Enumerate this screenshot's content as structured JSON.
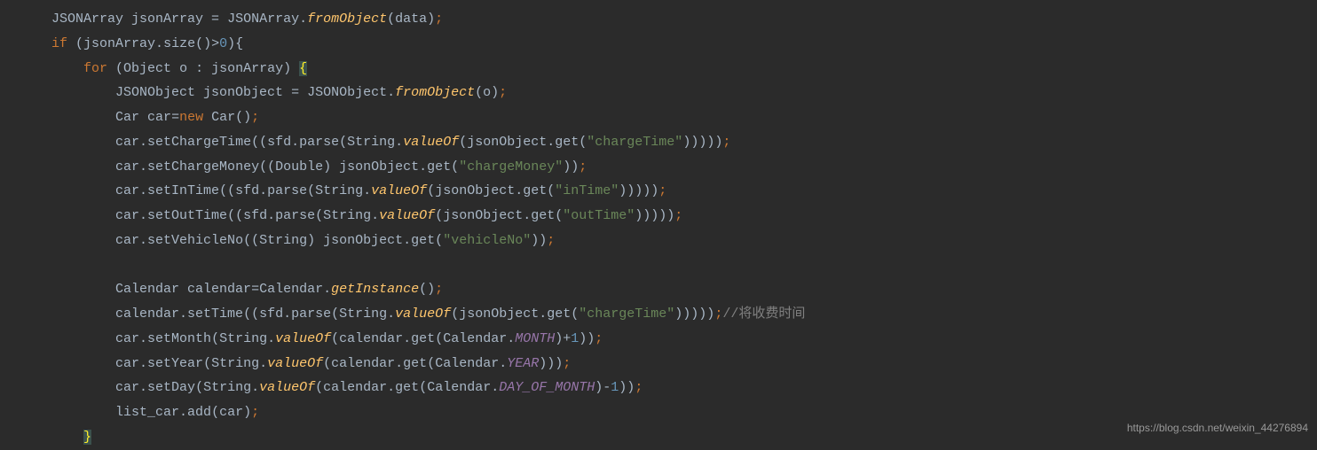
{
  "code": {
    "l1": {
      "type": "JSONArray",
      "var": "jsonArray",
      "eq": " = ",
      "cls": "JSONArray",
      "dot": ".",
      "method": "fromObject",
      "arg": "data"
    },
    "l2": {
      "kw": "if",
      "var": "jsonArray",
      "method": "size",
      "op": ">",
      "num": "0"
    },
    "l3": {
      "kw": "for",
      "type": "Object",
      "var": "o",
      "colon": " : ",
      "iter": "jsonArray"
    },
    "l4": {
      "type": "JSONObject",
      "var": "jsonObject",
      "eq": " = ",
      "cls": "JSONObject",
      "method": "fromObject",
      "arg": "o"
    },
    "l5": {
      "type": "Car",
      "var": "car",
      "newkw": "new",
      "ctor": "Car"
    },
    "l6": {
      "var": "car",
      "method": "setChargeTime",
      "sfd": "sfd",
      "parse": "parse",
      "strcls": "String",
      "valueof": "valueOf",
      "jo": "jsonObject",
      "get": "get",
      "str": "\"chargeTime\""
    },
    "l7": {
      "var": "car",
      "method": "setChargeMoney",
      "cast": "Double",
      "jo": "jsonObject",
      "get": "get",
      "str": "\"chargeMoney\""
    },
    "l8": {
      "var": "car",
      "method": "setInTime",
      "sfd": "sfd",
      "parse": "parse",
      "strcls": "String",
      "valueof": "valueOf",
      "jo": "jsonObject",
      "get": "get",
      "str": "\"inTime\""
    },
    "l9": {
      "var": "car",
      "method": "setOutTime",
      "sfd": "sfd",
      "parse": "parse",
      "strcls": "String",
      "valueof": "valueOf",
      "jo": "jsonObject",
      "get": "get",
      "str": "\"outTime\""
    },
    "l10": {
      "var": "car",
      "method": "setVehicleNo",
      "cast": "String",
      "jo": "jsonObject",
      "get": "get",
      "str": "\"vehicleNo\""
    },
    "l12": {
      "type": "Calendar",
      "var": "calendar",
      "cls": "Calendar",
      "method": "getInstance"
    },
    "l13": {
      "var": "calendar",
      "method": "setTime",
      "sfd": "sfd",
      "parse": "parse",
      "strcls": "String",
      "valueof": "valueOf",
      "jo": "jsonObject",
      "get": "get",
      "str": "\"chargeTime\"",
      "comment": "//将收费时间"
    },
    "l14": {
      "var": "car",
      "method": "setMonth",
      "strcls": "String",
      "valueof": "valueOf",
      "cal": "calendar",
      "get": "get",
      "calcls": "Calendar",
      "field": "MONTH",
      "num": "1"
    },
    "l15": {
      "var": "car",
      "method": "setYear",
      "strcls": "String",
      "valueof": "valueOf",
      "cal": "calendar",
      "get": "get",
      "calcls": "Calendar",
      "field": "YEAR"
    },
    "l16": {
      "var": "car",
      "method": "setDay",
      "strcls": "String",
      "valueof": "valueOf",
      "cal": "calendar",
      "get": "get",
      "calcls": "Calendar",
      "field": "DAY_OF_MONTH",
      "num": "1"
    },
    "l17": {
      "var": "list_car",
      "method": "add",
      "arg": "car"
    }
  },
  "watermark": "https://blog.csdn.net/weixin_44276894"
}
